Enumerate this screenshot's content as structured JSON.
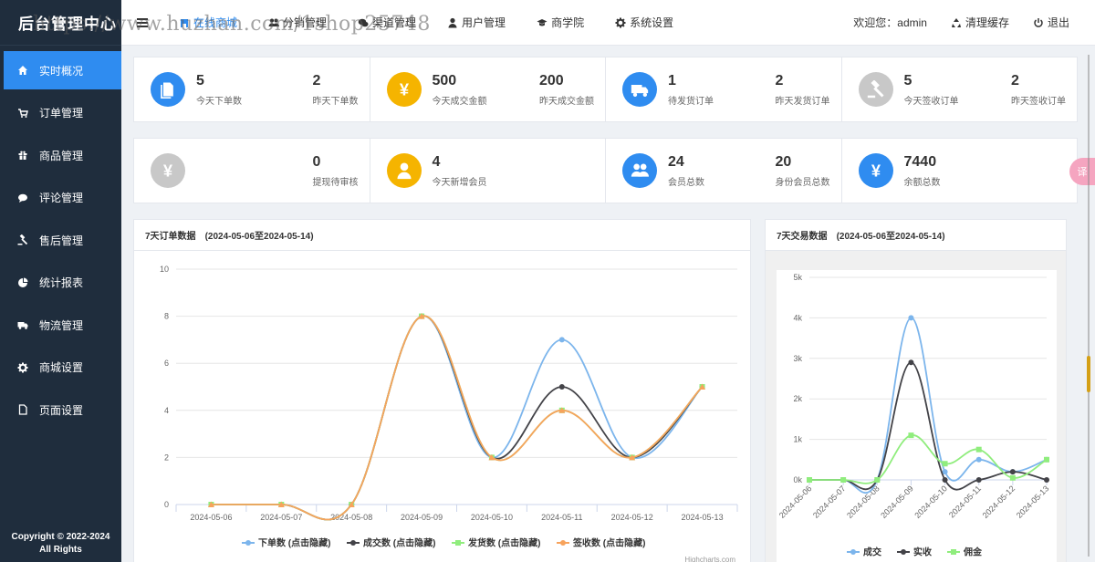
{
  "app": {
    "title": "后台管理中心",
    "copyright_line1": "Copyright © 2022-2024",
    "copyright_line2": "All Rights"
  },
  "watermark": "https://www.huzhan.com/1shop25748",
  "sidebar": {
    "items": [
      {
        "label": "实时概况",
        "icon": "home-icon",
        "active": true
      },
      {
        "label": "订单管理",
        "icon": "cart-icon"
      },
      {
        "label": "商品管理",
        "icon": "gift-icon"
      },
      {
        "label": "评论管理",
        "icon": "comment-icon"
      },
      {
        "label": "售后管理",
        "icon": "gavel-icon"
      },
      {
        "label": "统计报表",
        "icon": "pie-icon"
      },
      {
        "label": "物流管理",
        "icon": "truck-icon"
      },
      {
        "label": "商城设置",
        "icon": "gear-icon"
      },
      {
        "label": "页面设置",
        "icon": "file-icon"
      }
    ]
  },
  "topnav": {
    "items": [
      {
        "label": "在线商城",
        "icon": "store-icon",
        "active": true
      },
      {
        "label": "分销管理",
        "icon": "users-icon"
      },
      {
        "label": "渠道管理",
        "icon": "chat-icon"
      },
      {
        "label": "用户管理",
        "icon": "user-icon"
      },
      {
        "label": "商学院",
        "icon": "graduation-icon"
      },
      {
        "label": "系统设置",
        "icon": "gear-icon"
      }
    ],
    "welcome": "欢迎您：admin",
    "clear_cache": "清理缓存",
    "logout": "退出"
  },
  "stats_row1": [
    {
      "icon": "document-icon",
      "color": "#2f8cf0",
      "v1": "5",
      "l1": "今天下单数",
      "v2": "2",
      "l2": "昨天下单数"
    },
    {
      "icon": "yen-icon",
      "color": "#f5b400",
      "v1": "500",
      "l1": "今天成交金额",
      "v2": "200",
      "l2": "昨天成交金额"
    },
    {
      "icon": "truck-icon",
      "color": "#2f8cf0",
      "v1": "1",
      "l1": "待发货订单",
      "v2": "2",
      "l2": "昨天发货订单"
    },
    {
      "icon": "gavel-icon",
      "color": "#c8c8c8",
      "v1": "5",
      "l1": "今天签收订单",
      "v2": "2",
      "l2": "昨天签收订单"
    }
  ],
  "stats_row2": [
    {
      "icon": "yen-icon",
      "color": "#c8c8c8",
      "v1": "",
      "l1": "",
      "v2": "0",
      "l2": "提现待审核"
    },
    {
      "icon": "user-icon",
      "color": "#f5b400",
      "v1": "4",
      "l1": "今天新增会员",
      "v2": "",
      "l2": ""
    },
    {
      "icon": "users-icon",
      "color": "#2f8cf0",
      "v1": "24",
      "l1": "会员总数",
      "v2": "20",
      "l2": "身份会员总数"
    },
    {
      "icon": "yen-icon",
      "color": "#2f8cf0",
      "v1": "7440",
      "l1": "余额总数",
      "v2": "",
      "l2": ""
    }
  ],
  "chart_data": [
    {
      "type": "line",
      "title": "7天订单数据",
      "subtitle": "(2024-05-06至2024-05-14)",
      "x": [
        "2024-05-06",
        "2024-05-07",
        "2024-05-08",
        "2024-05-09",
        "2024-05-10",
        "2024-05-11",
        "2024-05-12",
        "2024-05-13"
      ],
      "ylim": [
        0,
        10
      ],
      "yticks": [
        0,
        2,
        4,
        6,
        8,
        10
      ],
      "series": [
        {
          "name": "下单数 (点击隐藏)",
          "color": "#7cb5ec",
          "values": [
            0,
            0,
            0,
            8,
            2,
            7,
            2,
            5
          ]
        },
        {
          "name": "成交数 (点击隐藏)",
          "color": "#434348",
          "values": [
            0,
            0,
            0,
            8,
            2,
            5,
            2,
            5
          ]
        },
        {
          "name": "发货数 (点击隐藏)",
          "color": "#90ed7d",
          "values": [
            0,
            0,
            0,
            8,
            2,
            4,
            2,
            5
          ]
        },
        {
          "name": "签收数 (点击隐藏)",
          "color": "#f7a35c",
          "values": [
            0,
            0,
            0,
            8,
            2,
            4,
            2,
            5
          ]
        }
      ],
      "credit": "Highcharts.com",
      "grid": true,
      "legend": "bottom"
    },
    {
      "type": "line",
      "title": "7天交易数据",
      "subtitle": "(2024-05-06至2024-05-14)",
      "x": [
        "2024-05-06",
        "2024-05-07",
        "2024-05-08",
        "2024-05-09",
        "2024-05-10",
        "2024-05-11",
        "2024-05-12",
        "2024-05-13"
      ],
      "ylim": [
        0,
        5000
      ],
      "yticks": [
        0,
        1000,
        2000,
        3000,
        4000,
        5000
      ],
      "ytick_labels": [
        "0k",
        "1k",
        "2k",
        "3k",
        "4k",
        "5k"
      ],
      "series": [
        {
          "name": "成交",
          "color": "#7cb5ec",
          "values": [
            0,
            0,
            0,
            4000,
            200,
            500,
            200,
            500
          ]
        },
        {
          "name": "实收",
          "color": "#434348",
          "values": [
            0,
            0,
            0,
            2900,
            0,
            0,
            200,
            0
          ]
        },
        {
          "name": "佣金",
          "color": "#90ed7d",
          "values": [
            0,
            0,
            0,
            1100,
            400,
            750,
            50,
            500
          ]
        }
      ],
      "grid": true,
      "legend": "bottom"
    }
  ]
}
